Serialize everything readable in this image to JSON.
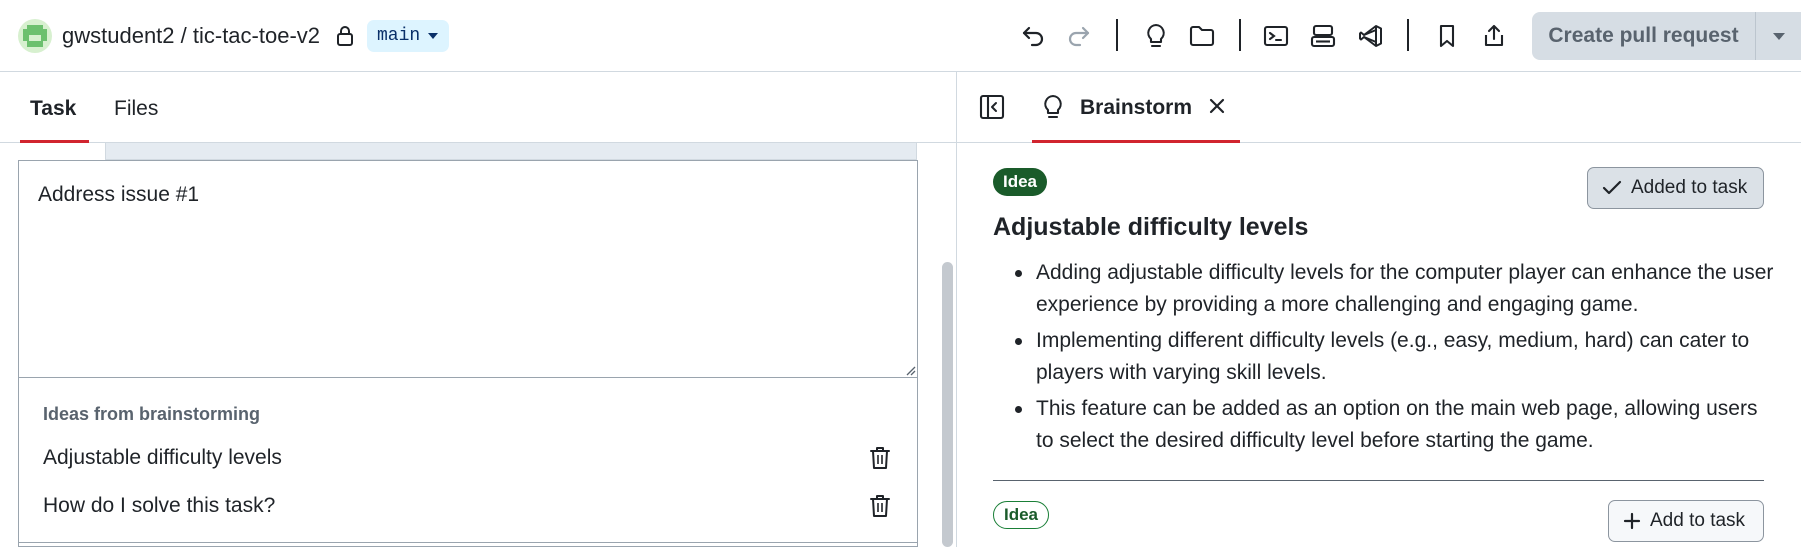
{
  "header": {
    "repo_path": "gwstudent2 / tic-tac-toe-v2",
    "branch": "main",
    "create_pr_label": "Create pull request",
    "toolbar_icons": [
      "undo-icon",
      "redo-icon",
      "lightbulb-icon",
      "folder-icon",
      "terminal-icon",
      "codespace-icon",
      "vscode-icon",
      "bookmark-icon",
      "share-icon"
    ]
  },
  "left_pane": {
    "tabs": [
      {
        "label": "Task",
        "active": true
      },
      {
        "label": "Files",
        "active": false
      }
    ],
    "task_text": "Address issue #1",
    "ideas_heading": "Ideas from brainstorming",
    "ideas": [
      {
        "label": "Adjustable difficulty levels"
      },
      {
        "label": "How do I solve this task?"
      }
    ]
  },
  "right_pane": {
    "tab_label": "Brainstorm",
    "cards": [
      {
        "badge": "Idea",
        "action_label": "Added to task",
        "title": "Adjustable difficulty levels",
        "bullets": [
          "Adding adjustable difficulty levels for the computer player can enhance the user experience by providing a more challenging and engaging game.",
          "Implementing different difficulty levels (e.g., easy, medium, hard) can cater to players with varying skill levels.",
          "This feature can be added as an option on the main web page, allowing users to select the desired difficulty level before starting the game."
        ]
      },
      {
        "badge": "Idea",
        "action_label": "Add to task"
      }
    ]
  },
  "colors": {
    "accent_underline": "#d1242f",
    "branch_bg": "#ddf4ff",
    "idea_badge": "#1a5b2a",
    "button_disabled_bg": "#d6dde4"
  }
}
